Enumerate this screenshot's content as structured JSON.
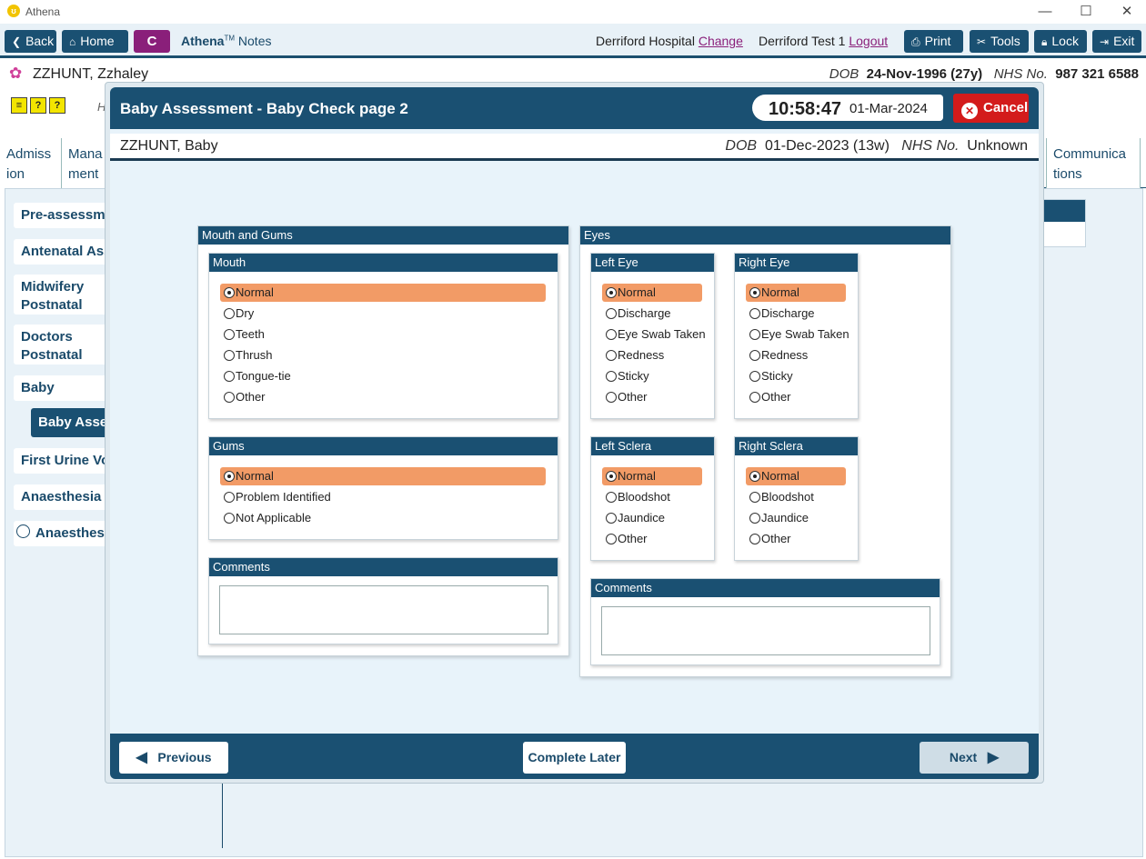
{
  "window": {
    "title": "Athena",
    "controls": {
      "minimize": "—",
      "maximize": "☐",
      "close": "✕"
    }
  },
  "toolbar": {
    "back": "Back",
    "home": "Home",
    "c_button": "C",
    "app_name": "Athena",
    "app_tm": "TM",
    "app_sub": "Notes",
    "hospital": "Derriford Hospital",
    "change": "Change",
    "user": "Derriford Test 1",
    "logout": "Logout",
    "print": "Print",
    "tools": "Tools",
    "lock": "Lock",
    "exit": "Exit"
  },
  "patient": {
    "name": "ZZHUNT, Zzhaley",
    "dob_label": "DOB",
    "dob": "24-Nov-1996 (27y)",
    "nhs_label": "NHS No.",
    "nhs": "987 321 6588"
  },
  "background": {
    "h_label": "H",
    "tabs": [
      "Admiss ion",
      "Mana ment",
      "Communica tions"
    ],
    "sidebar": [
      "Pre-assessment",
      "Antenatal Assessments",
      "Midwifery Postnatal Assessments",
      "Doctors Postnatal Assessments",
      "Baby",
      "Baby Assessment",
      "First Urine Void",
      "Anaesthesia In",
      "Anaesthesia"
    ]
  },
  "modal": {
    "title": "Baby Assessment - Baby Check page 2",
    "time": "10:58:47",
    "date": "01-Mar-2024",
    "cancel": "Cancel",
    "baby_name": "ZZHUNT, Baby",
    "dob_label": "DOB",
    "dob": "01-Dec-2023 (13w)",
    "nhs_label": "NHS No.",
    "nhs": "Unknown",
    "mouth_gums": {
      "title": "Mouth and Gums",
      "mouth": {
        "title": "Mouth",
        "options": [
          "Normal",
          "Dry",
          "Teeth",
          "Thrush",
          "Tongue-tie",
          "Other"
        ],
        "selected": "Normal"
      },
      "gums": {
        "title": "Gums",
        "options": [
          "Normal",
          "Problem Identified",
          "Not Applicable"
        ],
        "selected": "Normal"
      },
      "comments": {
        "title": "Comments",
        "value": ""
      }
    },
    "eyes": {
      "title": "Eyes",
      "left_eye": {
        "title": "Left Eye",
        "options": [
          "Normal",
          "Discharge",
          "Eye Swab Taken",
          "Redness",
          "Sticky",
          "Other"
        ],
        "selected": "Normal"
      },
      "right_eye": {
        "title": "Right Eye",
        "options": [
          "Normal",
          "Discharge",
          "Eye Swab Taken",
          "Redness",
          "Sticky",
          "Other"
        ],
        "selected": "Normal"
      },
      "left_sclera": {
        "title": "Left Sclera",
        "options": [
          "Normal",
          "Bloodshot",
          "Jaundice",
          "Other"
        ],
        "selected": "Normal"
      },
      "right_sclera": {
        "title": "Right Sclera",
        "options": [
          "Normal",
          "Bloodshot",
          "Jaundice",
          "Other"
        ],
        "selected": "Normal"
      },
      "comments": {
        "title": "Comments",
        "value": ""
      }
    },
    "footer": {
      "previous": "Previous",
      "complete_later": "Complete Later",
      "next": "Next"
    }
  },
  "colors": {
    "primary": "#1a5072",
    "selected": "#f29b66",
    "cancel": "#d31b1b",
    "c_button": "#8a1f7a"
  }
}
